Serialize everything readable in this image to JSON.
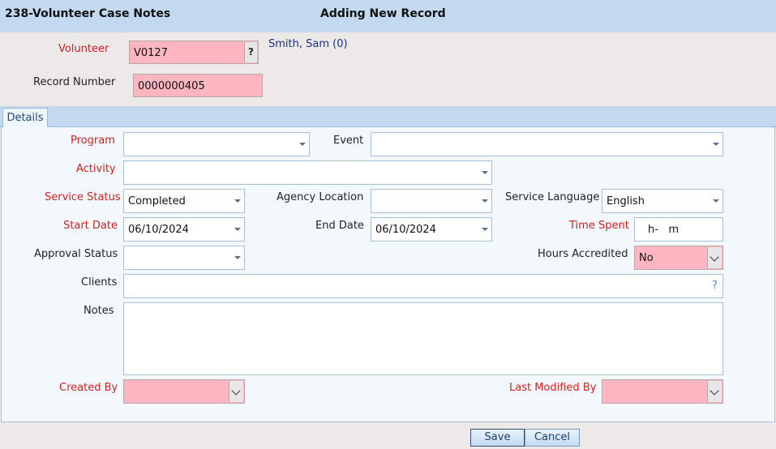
{
  "window": {
    "title": "238-Volunteer Case Notes",
    "mode": "Adding New Record"
  },
  "header_fields": {
    "volunteer_label": "Volunteer",
    "volunteer_value": "V0127",
    "volunteer_help": "?",
    "volunteer_name": "Smith, Sam (0)",
    "record_number_label": "Record Number",
    "record_number_value": "0000000405"
  },
  "tabs": [
    {
      "label": "Details",
      "active": true
    }
  ],
  "details": {
    "program_label": "Program",
    "program_value": "",
    "event_label": "Event",
    "event_value": "",
    "activity_label": "Activity",
    "activity_value": "",
    "service_status_label": "Service Status",
    "service_status_value": "Completed",
    "agency_location_label": "Agency Location",
    "agency_location_value": "",
    "service_language_label": "Service Language",
    "service_language_value": "English",
    "start_date_label": "Start Date",
    "start_date_value": "06/10/2024",
    "end_date_label": "End Date",
    "end_date_value": "06/10/2024",
    "time_spent_label": "Time Spent",
    "time_spent_value": "h-   m",
    "approval_status_label": "Approval Status",
    "approval_status_value": "",
    "hours_accredited_label": "Hours Accredited",
    "hours_accredited_value": "No",
    "clients_label": "Clients",
    "clients_value": "",
    "clients_help": "?",
    "notes_label": "Notes",
    "notes_value": "",
    "created_by_label": "Created By",
    "created_by_value": "",
    "last_modified_by_label": "Last Modified By",
    "last_modified_by_value": ""
  },
  "buttons": {
    "save": "Save",
    "cancel": "Cancel"
  },
  "colors": {
    "required_label": "#d0201f",
    "required_field": "#ffb6c1",
    "header_bar": "#c3d9ef",
    "link_text": "#1a2f8f"
  }
}
